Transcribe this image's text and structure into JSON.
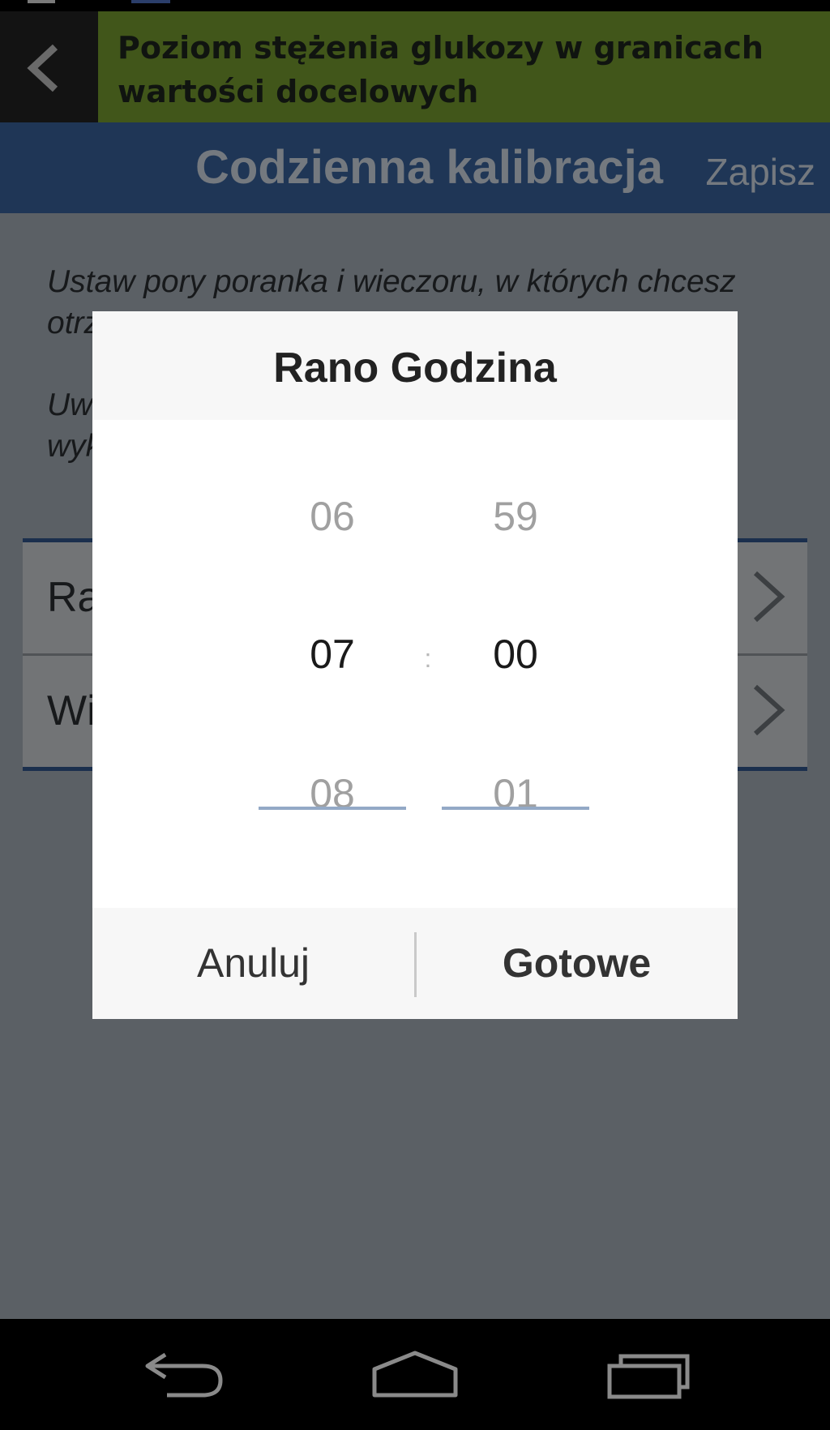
{
  "header": {
    "banner_text": "Poziom stężenia glukozy w granicach wartości docelowych",
    "banner_color": "#41561a",
    "back_icon": "chevron-left-icon"
  },
  "title_bar": {
    "title": "Codzienna kalibracja",
    "save_label": "Zapisz",
    "background_color": "#1f3656"
  },
  "intro": {
    "line1": "Ustaw pory poranka i wieczoru, w których chcesz",
    "line2": "otrz",
    "line3": "Uw",
    "line4": "wyk"
  },
  "settings": {
    "items": [
      {
        "label": "Ra",
        "icon": "chevron-right-icon"
      },
      {
        "label": "Wi",
        "icon": "chevron-right-icon"
      }
    ]
  },
  "dialog": {
    "title": "Rano Godzina",
    "hours": {
      "prev": "06",
      "current": "07",
      "next": "08"
    },
    "minutes": {
      "prev": "59",
      "current": "00",
      "next": "01"
    },
    "separator": ":",
    "cancel_label": "Anuluj",
    "done_label": "Gotowe",
    "accent_color": "#93a9c6"
  },
  "nav": {
    "back_icon": "back-icon",
    "home_icon": "home-icon",
    "recent_icon": "recent-apps-icon"
  }
}
